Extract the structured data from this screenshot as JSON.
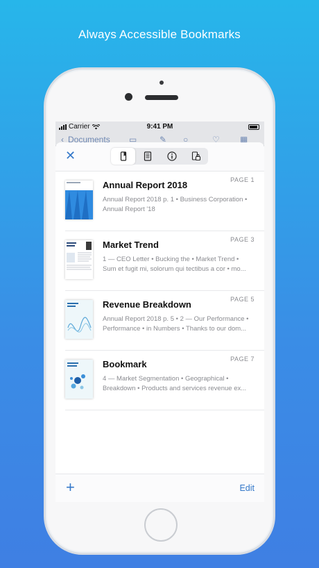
{
  "promo": {
    "title": "Always Accessible Bookmarks"
  },
  "status_bar": {
    "carrier": "Carrier",
    "time": "9:41 PM"
  },
  "background_toolbar": {
    "back_label": "Documents"
  },
  "sheet": {
    "segments": [
      "bookmarks-icon",
      "outline-icon",
      "info-icon",
      "lock-icon"
    ],
    "active_segment": "bookmarks-icon",
    "add_label": "+",
    "edit_label": "Edit",
    "bookmarks": [
      {
        "title": "Annual Report 2018",
        "page": "PAGE 1",
        "snippet_line1": "Annual Report 2018 p. 1 • Business Corporation •",
        "snippet_line2": "Annual Report '18"
      },
      {
        "title": "Market Trend",
        "page": "PAGE 3",
        "snippet_line1": "1 — CEO Letter • Bucking the • Market Trend •",
        "snippet_line2": "Sum et fugit mi, solorum qui tectibus a cor • mo..."
      },
      {
        "title": "Revenue Breakdown",
        "page": "PAGE 5",
        "snippet_line1": "Annual Report 2018 p. 5 • 2 — Our Performance •",
        "snippet_line2": "Performance • in Numbers • Thanks to our dom..."
      },
      {
        "title": "Bookmark",
        "page": "PAGE 7",
        "snippet_line1": "4 — Market Segmentation • Geographical •",
        "snippet_line2": "Breakdown • Products and services revenue ex..."
      }
    ]
  },
  "colors": {
    "accent": "#3478c9",
    "background_top": "#27b6ea",
    "background_bottom": "#3f7fe3"
  }
}
